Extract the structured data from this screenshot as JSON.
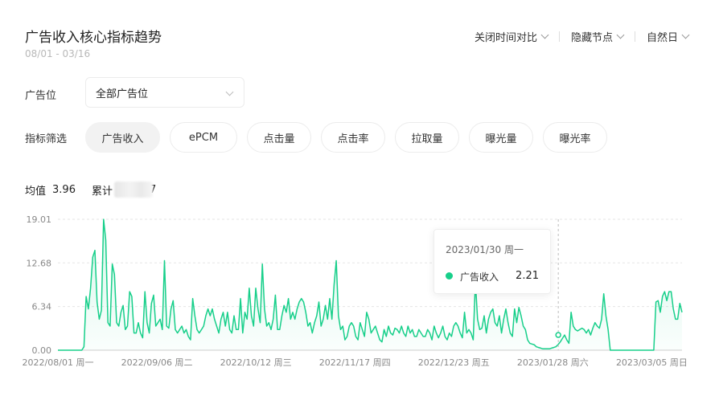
{
  "header": {
    "title": "广告收入核心指标趋势",
    "date_range": "08/01 - 03/16",
    "actions": [
      {
        "label": "关闭时间对比",
        "icon": "chevron-down-icon"
      },
      {
        "label": "隐藏节点",
        "icon": "chevron-down-icon"
      },
      {
        "label": "自然日",
        "icon": "chevron-down-icon"
      }
    ]
  },
  "filters": {
    "ad_slot_label": "广告位",
    "ad_slot_value": "全部广告位",
    "metric_label": "指标筛选",
    "metrics": [
      "广告收入",
      "ePCM",
      "点击量",
      "点击率",
      "拉取量",
      "曝光量",
      "曝光率"
    ],
    "active_metric": "广告收入"
  },
  "stats": {
    "avg_label": "均值",
    "avg_value": "3.96",
    "cum_label": "累计",
    "cum_suffix": "7"
  },
  "tooltip": {
    "date": "2023/01/30 周一",
    "series": "广告收入",
    "value": "2.21"
  },
  "colors": {
    "line": "#17cf8a",
    "fill_top": "#17cf8a",
    "grid": "#e5e5e5",
    "axis_text": "#888888",
    "crosshair": "#bbbbbb"
  },
  "chart_data": {
    "type": "area",
    "series_name": "广告收入",
    "y_ticks": [
      "0.00",
      "6.34",
      "12.68",
      "19.01"
    ],
    "ylim": [
      0,
      19.01
    ],
    "x_ticks": [
      "2022/08/01 周一",
      "2022/09/06 周二",
      "2022/10/12 周三",
      "2022/11/17 周四",
      "2022/12/23 周五",
      "2023/01/28 周六",
      "2023/03/05 周日"
    ],
    "x_range": [
      "2022/08/01",
      "2023/03/16"
    ],
    "total_days": 227,
    "grid": true,
    "values": [
      0,
      0,
      0,
      0,
      0,
      0,
      0,
      0,
      0,
      0,
      0,
      0,
      0.5,
      7.8,
      6,
      9,
      13.5,
      14.5,
      7,
      4.5,
      5.8,
      19,
      16,
      4,
      3.5,
      12.5,
      11,
      4,
      3.5,
      5.5,
      6.5,
      3,
      3.5,
      8.5,
      7.8,
      2.5,
      2.5,
      4,
      2.5,
      1.8,
      8.5,
      4,
      2.5,
      6.8,
      8,
      3.5,
      4,
      4.5,
      3,
      13,
      3.5,
      3.2,
      6,
      7.2,
      3,
      2.5,
      3,
      3.5,
      2.5,
      3,
      2,
      1.5,
      7.5,
      5,
      3,
      2.5,
      3,
      3.5,
      5,
      6,
      5,
      6,
      4.5,
      3.5,
      2.5,
      4.5,
      5.5,
      3.5,
      5.5,
      3,
      2.5,
      5,
      3,
      3,
      7.5,
      2.5,
      5.5,
      4.5,
      9,
      5,
      3.5,
      9,
      6,
      4,
      12.5,
      6,
      3.5,
      4,
      3,
      4.5,
      8,
      3,
      3,
      5,
      6.5,
      5.5,
      7.5,
      4.5,
      5.5,
      4.5,
      6,
      7,
      7.5,
      7,
      5.5,
      3.5,
      4,
      2.5,
      4,
      5,
      7,
      3.5,
      4.5,
      6.5,
      4.5,
      7.5,
      4.5,
      9.5,
      13,
      5,
      3,
      3.5,
      1.5,
      2,
      3.5,
      4,
      3.5,
      2,
      1.5,
      4,
      3,
      2,
      5.5,
      4.5,
      2.5,
      3,
      3.5,
      2.5,
      1.5,
      1.2,
      3,
      2,
      3.5,
      2.5,
      2.2,
      3.2,
      3,
      2.5,
      3.5,
      2.5,
      2,
      3.5,
      2.5,
      3,
      2,
      2,
      3,
      2.5,
      2,
      2,
      3,
      2.5,
      1.5,
      3.5,
      2.5,
      1.8,
      2.5,
      3.5,
      2,
      1.5,
      2.5,
      2,
      3.5,
      4,
      3.5,
      2.5,
      1.8,
      5.5,
      2.5,
      3,
      2.5,
      1.5,
      10,
      4.5,
      3,
      3.2,
      5,
      2.5,
      4.5,
      5.5,
      6,
      4,
      3.5,
      5,
      2.5,
      4.5,
      6,
      4,
      2.5,
      2,
      6,
      4,
      6.2,
      5,
      3.5,
      3,
      1.5,
      1,
      0.9,
      0.8,
      0.5,
      0.4,
      0.3,
      0.2,
      0.2,
      0.2,
      0.2,
      0.3,
      0.4,
      0.5,
      0.8,
      1.2,
      1.7,
      2.21,
      1.5,
      1,
      5.5,
      3.5,
      3,
      2.8,
      3,
      3.2,
      3,
      2.5,
      3,
      2.2,
      3.2,
      4,
      3.5,
      3.2,
      4.5,
      8.2,
      5,
      3,
      0,
      0,
      0,
      0,
      0,
      0,
      0,
      0,
      0,
      0,
      0,
      0,
      0,
      0,
      0,
      0,
      0,
      0,
      0,
      0,
      0,
      7,
      7.2,
      5.5,
      7.8,
      8.5,
      7.2,
      8.5,
      8.5,
      6,
      4.5,
      4.5,
      6.8,
      5.5
    ]
  }
}
